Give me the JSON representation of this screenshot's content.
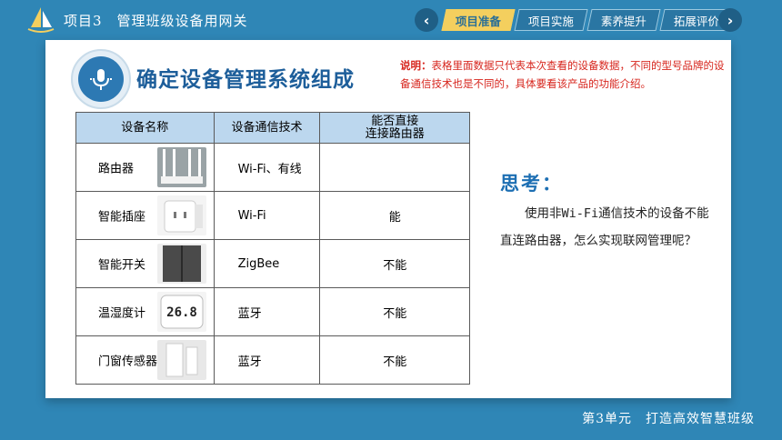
{
  "header": {
    "project_title": "项目3　管理班级设备用网关",
    "tabs": [
      {
        "label": "项目准备",
        "active": true
      },
      {
        "label": "项目实施",
        "active": false
      },
      {
        "label": "素养提升",
        "active": false
      },
      {
        "label": "拓展评价",
        "active": false
      }
    ],
    "prev_icon": "chevron-left-icon",
    "next_icon": "chevron-right-icon"
  },
  "section_title": "确定设备管理系统组成",
  "note": {
    "label": "说明：",
    "text": "表格里面数据只代表本次查看的设备数据，不同的型号品牌的设备通信技术也是不同的，具体要看该产品的功能介绍。"
  },
  "table": {
    "headers": [
      "设备名称",
      "设备通信技术",
      "能否直接\n连接路由器"
    ],
    "header3_line1": "能否直接",
    "header3_line2": "连接路由器",
    "rows": [
      {
        "name": "路由器",
        "tech": "Wi-Fi、有线",
        "connect": ""
      },
      {
        "name": "智能插座",
        "tech": "Wi-Fi",
        "connect": "能"
      },
      {
        "name": "智能开关",
        "tech": "ZigBee",
        "connect": "不能"
      },
      {
        "name": "温湿度计",
        "tech": "蓝牙",
        "connect": "不能"
      },
      {
        "name": "门窗传感器",
        "tech": "蓝牙",
        "connect": "不能"
      }
    ],
    "thermo_reading": "26.8"
  },
  "think": {
    "heading": "思考：",
    "body": "使用非Wi-Fi通信技术的设备不能直连路由器，怎么实现联网管理呢？"
  },
  "footer": "第3单元　打造高效智慧班级",
  "colors": {
    "primary": "#2f86b6",
    "accent": "#f4cf5e",
    "title": "#1d5e9a",
    "note": "#d7261e"
  }
}
